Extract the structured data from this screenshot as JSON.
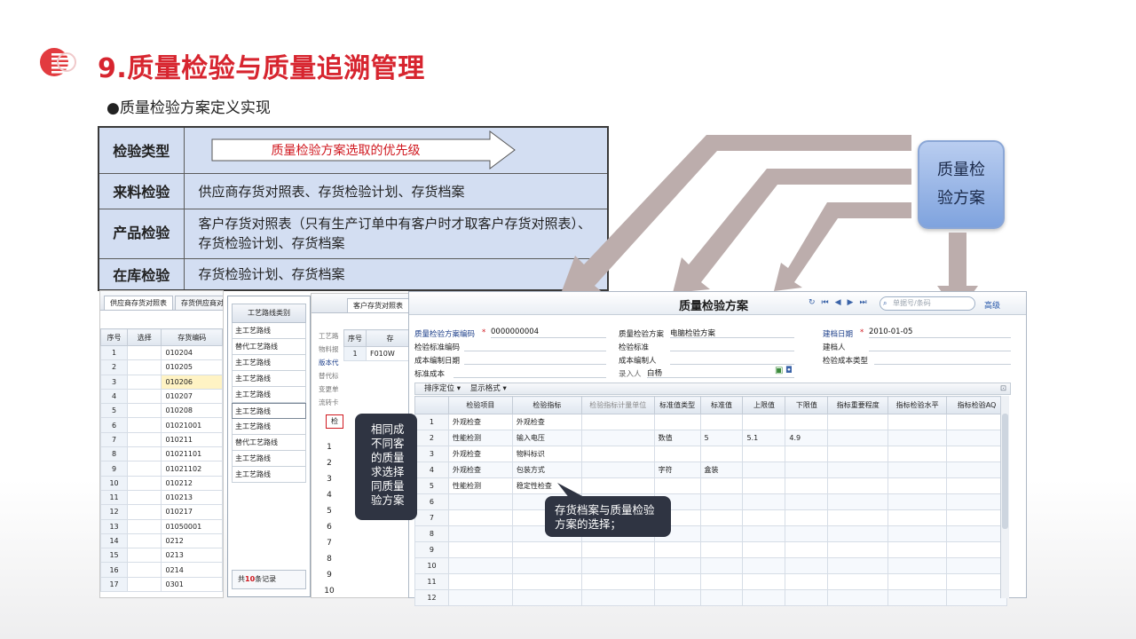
{
  "header": {
    "title": "9.质量检验与质量追溯管理",
    "subtitle": "●质量检验方案定义实现"
  },
  "priority_table": {
    "rows": [
      {
        "label": "检验类型",
        "content": "质量检验方案选取的优先级"
      },
      {
        "label": "来料检验",
        "content": "供应商存货对照表、存货检验计划、存货档案"
      },
      {
        "label": "产品检验",
        "content": "客户存货对照表（只有生产订单中有客户时才取客户存货对照表）、存货检验计划、存货档案"
      },
      {
        "label": "在库检验",
        "content": "存货检验计划、存货档案"
      }
    ]
  },
  "plan_box": {
    "line1": "质量检",
    "line2": "验方案"
  },
  "panel_a": {
    "tabs": [
      "供应商存货对照表",
      "存货供应商对照"
    ],
    "headers": [
      "序号",
      "选择",
      "存货编码"
    ],
    "rows": [
      {
        "no": "1",
        "code": "010204"
      },
      {
        "no": "2",
        "code": "010205"
      },
      {
        "no": "3",
        "code": "010206"
      },
      {
        "no": "4",
        "code": "010207"
      },
      {
        "no": "5",
        "code": "010208"
      },
      {
        "no": "6",
        "code": "01021001"
      },
      {
        "no": "7",
        "code": "010211"
      },
      {
        "no": "8",
        "code": "01021101"
      },
      {
        "no": "9",
        "code": "01021102"
      },
      {
        "no": "10",
        "code": "010212"
      },
      {
        "no": "11",
        "code": "010213"
      },
      {
        "no": "12",
        "code": "010217"
      },
      {
        "no": "13",
        "code": "01050001"
      },
      {
        "no": "14",
        "code": "0212"
      },
      {
        "no": "15",
        "code": "0213"
      },
      {
        "no": "16",
        "code": "0214"
      },
      {
        "no": "17",
        "code": "0301"
      }
    ]
  },
  "panel_b": {
    "header": "工艺路线类别",
    "items": [
      "主工艺路线",
      "替代工艺路线",
      "主工艺路线",
      "主工艺路线",
      "主工艺路线",
      "主工艺路线",
      "主工艺路线",
      "替代工艺路线",
      "主工艺路线",
      "主工艺路线"
    ],
    "footer_prefix": "共",
    "footer_count": "10",
    "footer_suffix": "条记录"
  },
  "panel_c": {
    "tab": "客户存货对照表",
    "headers": [
      "序号",
      "存"
    ],
    "row1": {
      "no": "1",
      "code": "F010W"
    },
    "side_labels": [
      "工艺路",
      "物料报",
      "版本代",
      "替代标",
      "变更单",
      "流转卡"
    ],
    "tab2": "检",
    "numbers": [
      "1",
      "2",
      "3",
      "4",
      "5",
      "6",
      "7",
      "8",
      "9",
      "10"
    ]
  },
  "main_window": {
    "title": "质量检验方案",
    "search_placeholder": "单据号/条码",
    "advanced": "高级",
    "form": {
      "code_label": "质量检验方案编码",
      "code_value": "0000000004",
      "plan_label": "质量检验方案",
      "plan_value": "电脑检验方案",
      "date_label": "建档日期",
      "date_value": "2010-01-05",
      "std_code_label": "检验标准编码",
      "std_label": "检验标准",
      "creator_label": "建档人",
      "cost_date_label": "成本编制日期",
      "cost_person_label": "成本编制人",
      "cost_type_label": "检验成本类型",
      "std_cost_label": "标准成本",
      "entry_label": "录入人",
      "entry_value": "白杨"
    },
    "toolbar": {
      "sort": "排序定位",
      "display": "显示格式"
    },
    "grid_headers": [
      "",
      "检验项目",
      "检验指标",
      "检验指标计量单位",
      "标准值类型",
      "标准值",
      "上限值",
      "下限值",
      "指标重要程度",
      "指标检验水平",
      "指标检验AQ"
    ],
    "grid_rows": [
      {
        "no": "1",
        "item": "外观检查",
        "index": "外观检查",
        "unit": "",
        "type": "",
        "std": "",
        "upper": "",
        "lower": ""
      },
      {
        "no": "2",
        "item": "性能检测",
        "index": "输入电压",
        "unit": "",
        "type": "数值",
        "std": "5",
        "upper": "5.1",
        "lower": "4.9"
      },
      {
        "no": "3",
        "item": "外观检查",
        "index": "物料标识",
        "unit": "",
        "type": "",
        "std": "",
        "upper": "",
        "lower": ""
      },
      {
        "no": "4",
        "item": "外观检查",
        "index": "包装方式",
        "unit": "",
        "type": "字符",
        "std": "盒装",
        "upper": "",
        "lower": ""
      },
      {
        "no": "5",
        "item": "性能检测",
        "index": "稳定性检查",
        "unit": "",
        "type": "",
        "std": "",
        "upper": "",
        "lower": ""
      },
      {
        "no": "6"
      },
      {
        "no": "7"
      },
      {
        "no": "8"
      },
      {
        "no": "9"
      },
      {
        "no": "10"
      },
      {
        "no": "11"
      },
      {
        "no": "12"
      }
    ]
  },
  "callouts": {
    "left_lines": [
      "相同成",
      "不同客",
      "的质量",
      "求选择",
      "同质量",
      "验方案"
    ],
    "bottom": "存货档案与质量检验方案的选择；"
  },
  "colors": {
    "title_red": "#d7252f",
    "table_bg": "#d3def2",
    "arrow_grey": "#bcadac",
    "callout_bg": "#2f3442"
  }
}
